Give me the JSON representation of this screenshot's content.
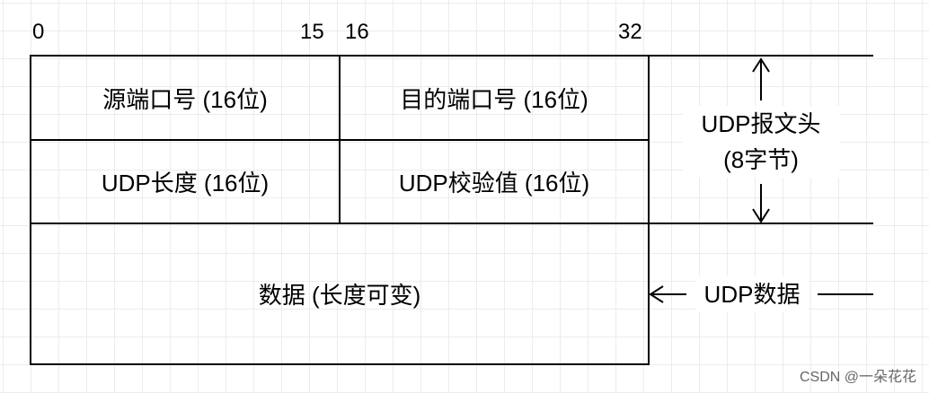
{
  "bit_labels": {
    "b0": "0",
    "b15": "15",
    "b16": "16",
    "b32": "32"
  },
  "fields": {
    "src_port": "源端口号 (16位)",
    "dst_port": "目的端口号 (16位)",
    "length": "UDP长度 (16位)",
    "checksum": "UDP校验值 (16位)",
    "data": "数据 (长度可变)"
  },
  "header_label": {
    "line1": "UDP报文头",
    "line2": "(8字节)"
  },
  "data_label": "UDP数据",
  "watermark": "CSDN @一朵花花"
}
